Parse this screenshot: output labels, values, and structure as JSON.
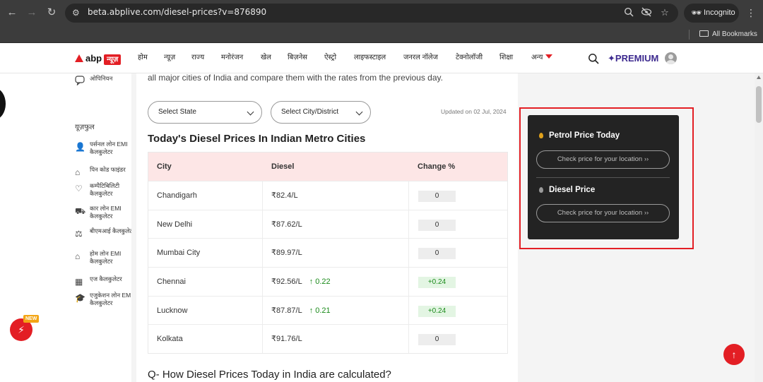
{
  "browser": {
    "url": "beta.abplive.com/diesel-prices?v=876890",
    "incognito_label": "Incognito",
    "bookmarks_label": "All Bookmarks"
  },
  "header": {
    "logo_text": "abp",
    "logo_tag": "न्यूज़",
    "nav": [
      "होम",
      "न्यूज़",
      "राज्य",
      "मनोरंजन",
      "खेल",
      "बिज़नेस",
      "ऐस्ट्रो",
      "लाइफस्टाइल",
      "जनरल नॉलेज",
      "टेक्नोलॉजी",
      "शिक्षा",
      "अन्य"
    ],
    "premium_label": "PREMIUM"
  },
  "sidebar": {
    "opinion": "ओपिनियन",
    "useful_heading": "यूज़फुल",
    "items": [
      {
        "label": "पर्सनल लोन EMI कैलकुलेटर",
        "icon": "person-icon"
      },
      {
        "label": "पिन कोड फाइंडर",
        "icon": "pin-icon"
      },
      {
        "label": "कम्पैटिबिलिटी कैलकुलेटर",
        "icon": "heart-icon"
      },
      {
        "label": "कार लोन EMI कैलकुलेटर",
        "icon": "car-icon"
      },
      {
        "label": "बीएमआई कैलकुलेटर",
        "icon": "scale-icon"
      },
      {
        "label": "होम लोन EMI कैलकुलेटर",
        "icon": "home-icon"
      },
      {
        "label": "एज कैलकुलेटर",
        "icon": "calculator-icon"
      },
      {
        "label": "एजुकेशन लोन EMI कैलकुलेटर",
        "icon": "education-icon"
      }
    ],
    "new_badge": "NEW"
  },
  "main": {
    "intro": "all major cities of India and compare them with the rates from the previous day.",
    "select_state": "Select State",
    "select_city": "Select City/District",
    "updated": "Updated on 02 Jul, 2024",
    "section_title": "Today's Diesel Prices In Indian Metro Cities",
    "table": {
      "headers": [
        "City",
        "Diesel",
        "Change %"
      ],
      "rows": [
        {
          "city": "Chandigarh",
          "diesel": "₹82.4/L",
          "rise": "",
          "change": "0"
        },
        {
          "city": "New Delhi",
          "diesel": "₹87.62/L",
          "rise": "",
          "change": "0"
        },
        {
          "city": "Mumbai City",
          "diesel": "₹89.97/L",
          "rise": "",
          "change": "0"
        },
        {
          "city": "Chennai",
          "diesel": "₹92.56/L",
          "rise": "0.22",
          "change": "+0.24"
        },
        {
          "city": "Lucknow",
          "diesel": "₹87.87/L",
          "rise": "0.21",
          "change": "+0.24"
        },
        {
          "city": "Kolkata",
          "diesel": "₹91.76/L",
          "rise": "",
          "change": "0"
        }
      ]
    },
    "faq_title": "Q- How Diesel Prices Today in India are calculated?"
  },
  "widget": {
    "petrol_title": "Petrol Price Today",
    "petrol_button": "Check price for your location ››",
    "diesel_title": "Diesel Price",
    "diesel_button": "Check price for your location ››",
    "colors": {
      "accent": "#e31e24",
      "petrol_drop": "#e0a11b",
      "diesel_drop": "#9a9a9a"
    }
  }
}
